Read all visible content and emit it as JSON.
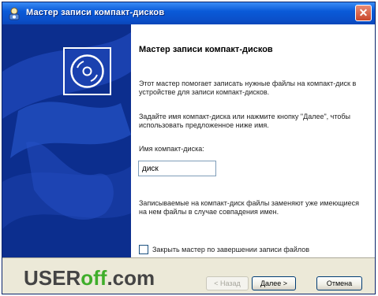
{
  "window": {
    "title": "Мастер записи компакт-дисков",
    "close_glyph": "✕"
  },
  "icons": {
    "window_icon": "cd-writer-icon",
    "close_icon": "close-icon",
    "banner_icon": "cd-disc-icon"
  },
  "content": {
    "heading": "Мастер записи компакт-дисков",
    "intro": "Этот мастер помогает записать нужные файлы на компакт-диск в устройстве для записи компакт-дисков.",
    "name_hint": "Задайте имя компакт-диска или нажмите кнопку \"Далее\", чтобы использовать предложенное ниже имя.",
    "name_label": "Имя компакт-диска:",
    "name_value": "диск",
    "overwrite_note": "Записываемые на компакт-диск файлы заменяют уже имеющиеся на нем файлы в случае совпадения имен.",
    "close_checkbox_label": "Закрыть мастер по завершении записи файлов",
    "close_checkbox_checked": false
  },
  "buttons": {
    "back": "< Назад",
    "next": "Далее >",
    "cancel": "Отмена"
  },
  "watermark": {
    "part1": "USER",
    "part2": "off",
    "part3": ".com"
  },
  "colors": {
    "titlebar": "#0A5AD8",
    "banner": "#0C2E8E",
    "watermark_green": "#3FAE2A"
  }
}
